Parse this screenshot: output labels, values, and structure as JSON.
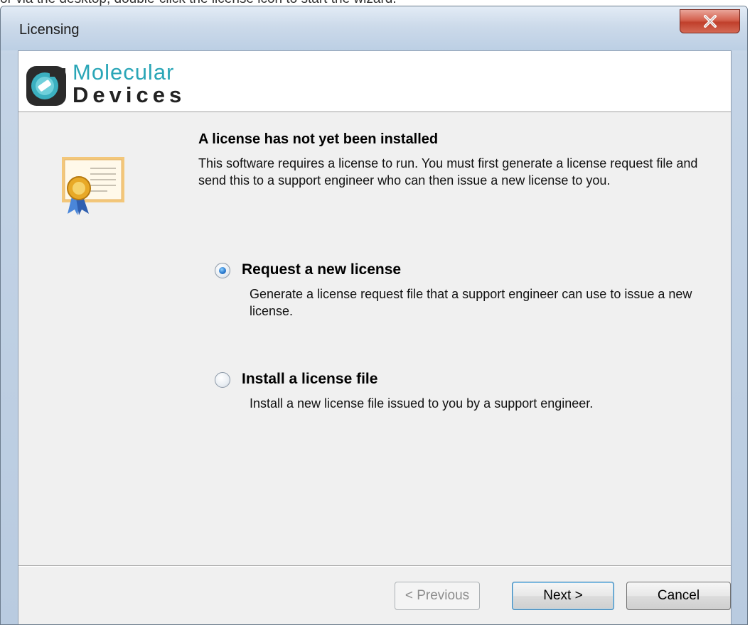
{
  "top_hint": "or via the desktop, double-click the license icon to start the wizard.",
  "window": {
    "title": "Licensing",
    "close_label": "Close"
  },
  "logo": {
    "word1": "Molecular",
    "word2": "Devices"
  },
  "content": {
    "heading": "A license has not yet been installed",
    "description": "This software requires a license to run. You must first generate a license request file and send this to a support engineer who can then issue a new license to you."
  },
  "options": [
    {
      "label": "Request a new license",
      "description": "Generate a license request file that a support engineer can use to issue a new license.",
      "selected": true
    },
    {
      "label": "Install a license file",
      "description": "Install a new license file issued to you by a support engineer.",
      "selected": false
    }
  ],
  "buttons": {
    "previous": "< Previous",
    "next": "Next >",
    "cancel": "Cancel"
  },
  "icons": {
    "logo": "molecular-devices-logo",
    "certificate": "certificate-icon",
    "close": "close-icon"
  }
}
